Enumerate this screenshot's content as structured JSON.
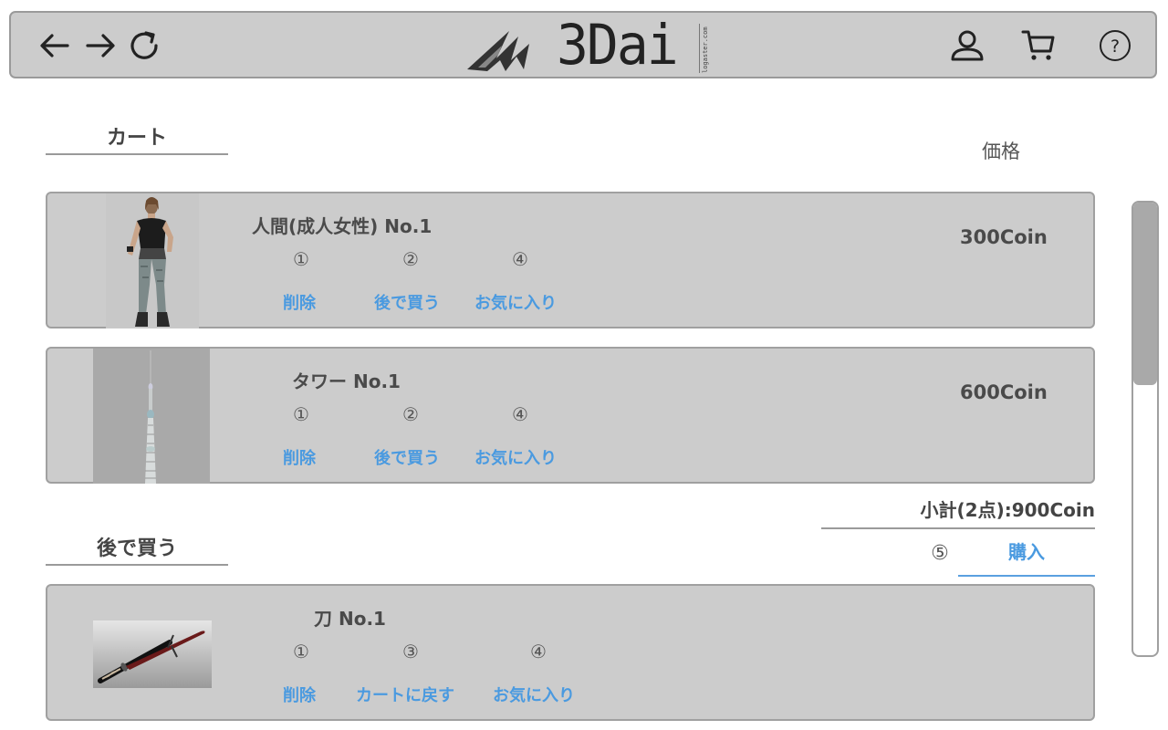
{
  "header": {
    "logo_text": "3Dai",
    "logo_sub": "logaster.com",
    "icons": [
      "back-icon",
      "forward-icon",
      "reload-icon",
      "user-icon",
      "cart-icon",
      "help-icon"
    ]
  },
  "cart": {
    "title": "カート",
    "price_header": "価格",
    "items": [
      {
        "name": "人間(成人女性) No.1",
        "markers": [
          "①",
          "②",
          "④"
        ],
        "actions": [
          "削除",
          "後で買う",
          "お気に入り"
        ],
        "price": "300Coin"
      },
      {
        "name": "タワー No.1",
        "markers": [
          "①",
          "②",
          "④"
        ],
        "actions": [
          "削除",
          "後で買う",
          "お気に入り"
        ],
        "price": "600Coin"
      }
    ],
    "subtotal": "小計(2点):900Coin",
    "buy_marker": "⑤",
    "buy_label": "購入"
  },
  "later": {
    "title": "後で買う",
    "items": [
      {
        "name": "刀 No.1",
        "markers": [
          "①",
          "③",
          "④"
        ],
        "actions": [
          "削除",
          "カートに戻す",
          "お気に入り"
        ]
      }
    ]
  },
  "colors": {
    "accent": "#4a9ae0",
    "panel": "#cccccc",
    "border": "#9a9a9a"
  }
}
